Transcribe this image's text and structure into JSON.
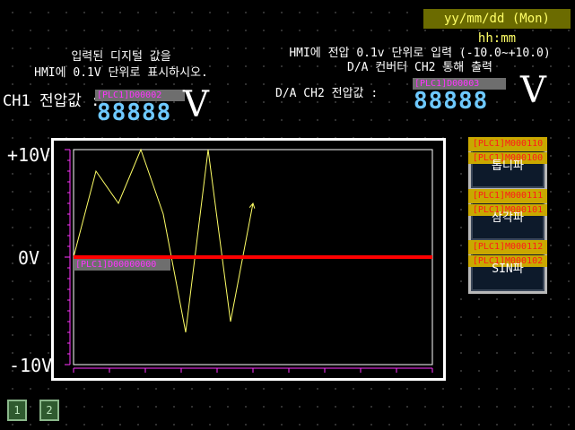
{
  "header": {
    "datetime": "yy/mm/dd (Mon) hh:mm",
    "left_note_line1": "입력된 디지털 값을",
    "left_note_line2": "HMI에 0.1V 단위로 표시하시오.",
    "right_note_line1": "HMI에 전압 0.1v 단위로 입력 (-10.0~+10.0)",
    "right_note_line2": "D/A 컨버터 CH2 통해 출력"
  },
  "ch1": {
    "label": "CH1 전압값 :",
    "tag": "[PLC1]D00002",
    "display": "88888",
    "unit": "V"
  },
  "ch2": {
    "label": "D/A CH2 전압값 :",
    "tag": "[PLC1]D00003",
    "display": "88888",
    "unit": "V"
  },
  "graph": {
    "y_max_label": "+10V",
    "y_zero_label": "0V",
    "y_min_label": "-10V",
    "level_tag": "[PLC1]D00000000",
    "level_line_color": "#ff0000",
    "trace_color": "#ffff66",
    "trace": [
      0,
      8,
      5,
      10,
      4,
      -7,
      10,
      -6,
      5
    ]
  },
  "buttons": [
    {
      "tag1": "[PLC1]M000110",
      "tag2": "[PLC1]M000100",
      "label": "톱니파"
    },
    {
      "tag1": "[PLC1]M000111",
      "tag2": "[PLC1]M000101",
      "label": "삼각파"
    },
    {
      "tag1": "[PLC1]M000112",
      "tag2": "[PLC1]M000102",
      "label": "SIN파"
    }
  ],
  "pages": [
    "1",
    "2"
  ]
}
